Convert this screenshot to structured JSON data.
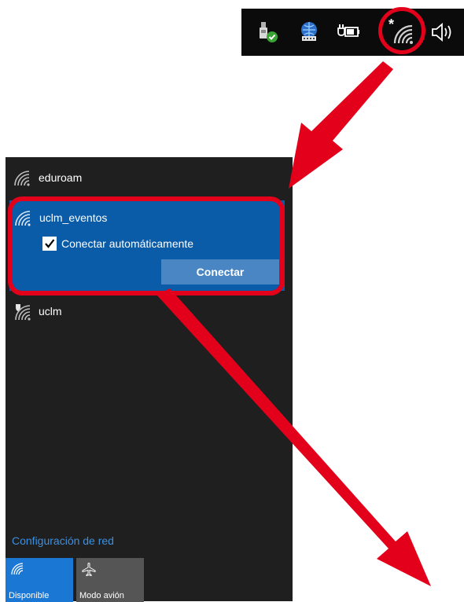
{
  "tray": {
    "icons": [
      "usb-safe-remove-icon",
      "network-share-icon",
      "battery-power-icon",
      "wifi-available-icon",
      "speaker-icon"
    ],
    "wifi_badge": "*"
  },
  "flyout": {
    "networks": [
      {
        "name": "eduroam",
        "icon": "wifi-icon",
        "secured": false
      },
      {
        "name": "uclm_eventos",
        "icon": "wifi-icon",
        "selected": true
      },
      {
        "name": "uclm",
        "icon": "wifi-shield-icon",
        "secured": true
      }
    ],
    "auto_connect_label": "Conectar automáticamente",
    "auto_connect_checked": true,
    "connect_button": "Conectar",
    "settings_link": "Configuración de red",
    "quick_actions": [
      {
        "label": "Disponible",
        "icon": "wifi-icon",
        "active": true
      },
      {
        "label": "Modo avión",
        "icon": "airplane-icon",
        "active": false
      }
    ]
  },
  "colors": {
    "flyout_bg": "#1f1f1f",
    "selected_bg": "#0a5ba8",
    "accent_link": "#3d8fe0",
    "annotation_red": "#e3001b"
  }
}
